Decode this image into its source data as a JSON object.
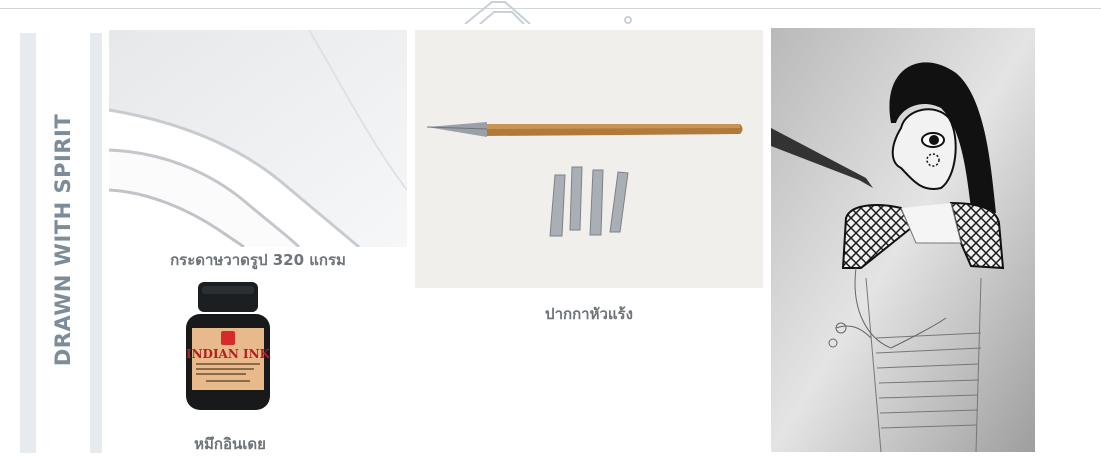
{
  "sidebar": {
    "vertical_title": "DRAWN WITH SPIRIT"
  },
  "items": [
    {
      "caption": "กระดาษวาดรูป 320 แกรม",
      "image": "drawing-paper-image"
    },
    {
      "caption": "ปากกาหัวแร้ง",
      "image": "dip-pen-and-nibs-image"
    },
    {
      "caption": "หมึกอินเดย",
      "image": "indian-ink-bottle-image"
    },
    {
      "caption": "",
      "image": "ink-drawing-of-woman-image"
    }
  ],
  "ink_label": {
    "brand": "INDIAN INK",
    "sub": "Oostindische inkt / Encre de Chine"
  },
  "colors": {
    "title": "#7c8c99",
    "bars": "#e7ebef",
    "caption": "#6e7479"
  }
}
